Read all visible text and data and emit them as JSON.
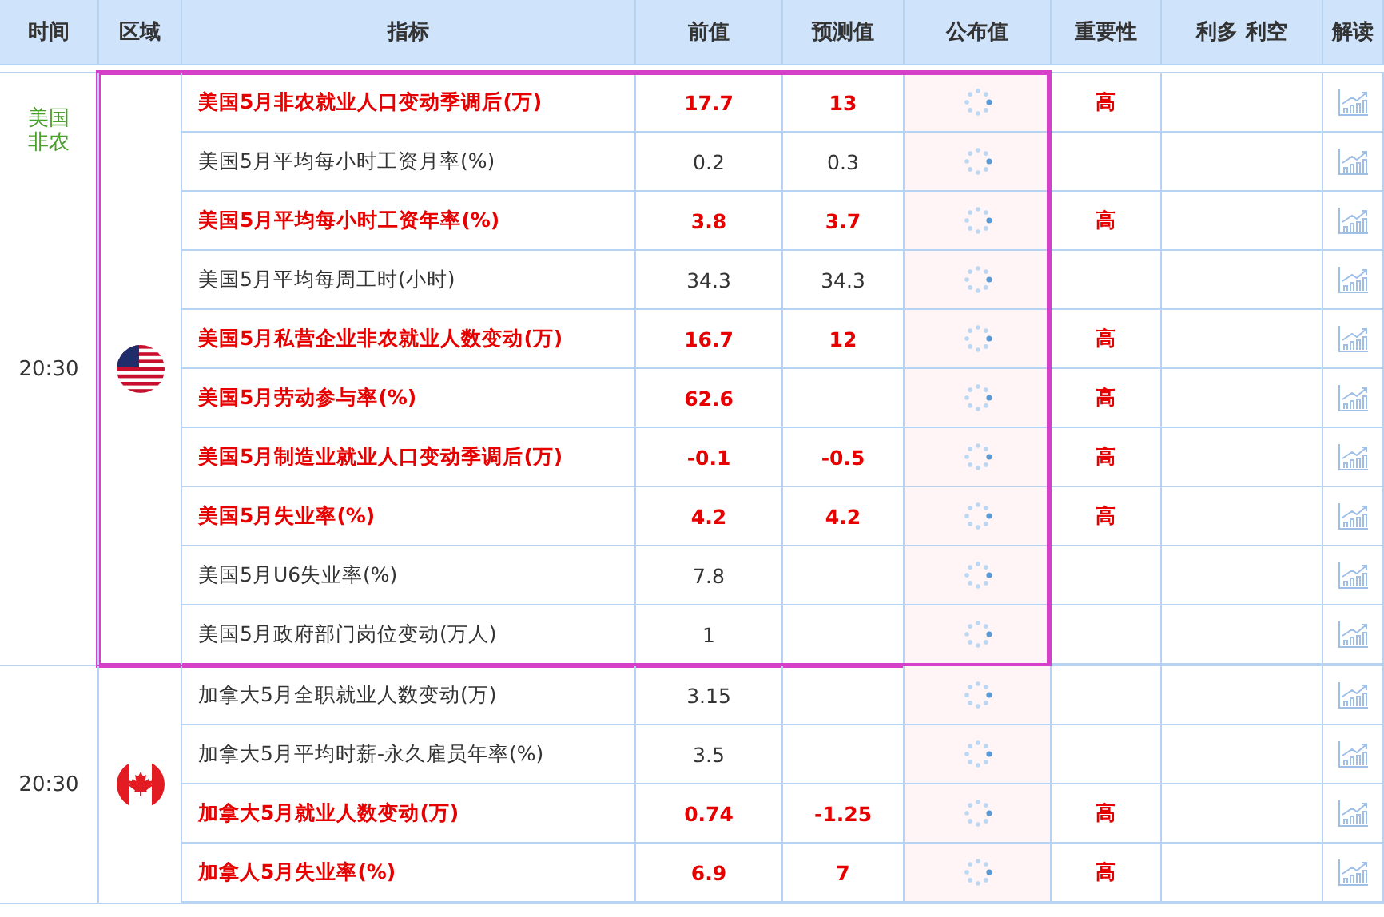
{
  "columns": [
    "时间",
    "区域",
    "指标",
    "前值",
    "预测值",
    "公布值",
    "重要性",
    "利多 利空",
    "解读"
  ],
  "groups": [
    {
      "time": "20:30",
      "tag": "美国非农",
      "kind": "us",
      "highlighted": true,
      "rows": [
        {
          "indicator": "美国5月非农就业人口变动季调后(万)",
          "previous": "17.7",
          "forecast": "13",
          "importance": "高",
          "important": true
        },
        {
          "indicator": "美国5月平均每小时工资月率(%)",
          "previous": "0.2",
          "forecast": "0.3",
          "importance": "",
          "important": false
        },
        {
          "indicator": "美国5月平均每小时工资年率(%)",
          "previous": "3.8",
          "forecast": "3.7",
          "importance": "高",
          "important": true
        },
        {
          "indicator": "美国5月平均每周工时(小时)",
          "previous": "34.3",
          "forecast": "34.3",
          "importance": "",
          "important": false
        },
        {
          "indicator": "美国5月私营企业非农就业人数变动(万)",
          "previous": "16.7",
          "forecast": "12",
          "importance": "高",
          "important": true
        },
        {
          "indicator": "美国5月劳动参与率(%)",
          "previous": "62.6",
          "forecast": "",
          "importance": "高",
          "important": true
        },
        {
          "indicator": "美国5月制造业就业人口变动季调后(万)",
          "previous": "-0.1",
          "forecast": "-0.5",
          "importance": "高",
          "important": true
        },
        {
          "indicator": "美国5月失业率(%)",
          "previous": "4.2",
          "forecast": "4.2",
          "importance": "高",
          "important": true
        },
        {
          "indicator": "美国5月U6失业率(%)",
          "previous": "7.8",
          "forecast": "",
          "importance": "",
          "important": false
        },
        {
          "indicator": "美国5月政府部门岗位变动(万人)",
          "previous": "1",
          "forecast": "",
          "importance": "",
          "important": false
        }
      ]
    },
    {
      "time": "20:30",
      "kind": "ca",
      "rows": [
        {
          "indicator": "加拿大5月全职就业人数变动(万)",
          "previous": "3.15",
          "forecast": "",
          "importance": "",
          "important": false
        },
        {
          "indicator": "加拿大5月平均时薪-永久雇员年率(%)",
          "previous": "3.5",
          "forecast": "",
          "importance": "",
          "important": false
        },
        {
          "indicator": "加拿大5月就业人数变动(万)",
          "previous": "0.74",
          "forecast": "-1.25",
          "importance": "高",
          "important": true
        },
        {
          "indicator": "加拿人5月失业率(%)",
          "previous": "6.9",
          "forecast": "7",
          "importance": "高",
          "important": true
        }
      ]
    }
  ]
}
